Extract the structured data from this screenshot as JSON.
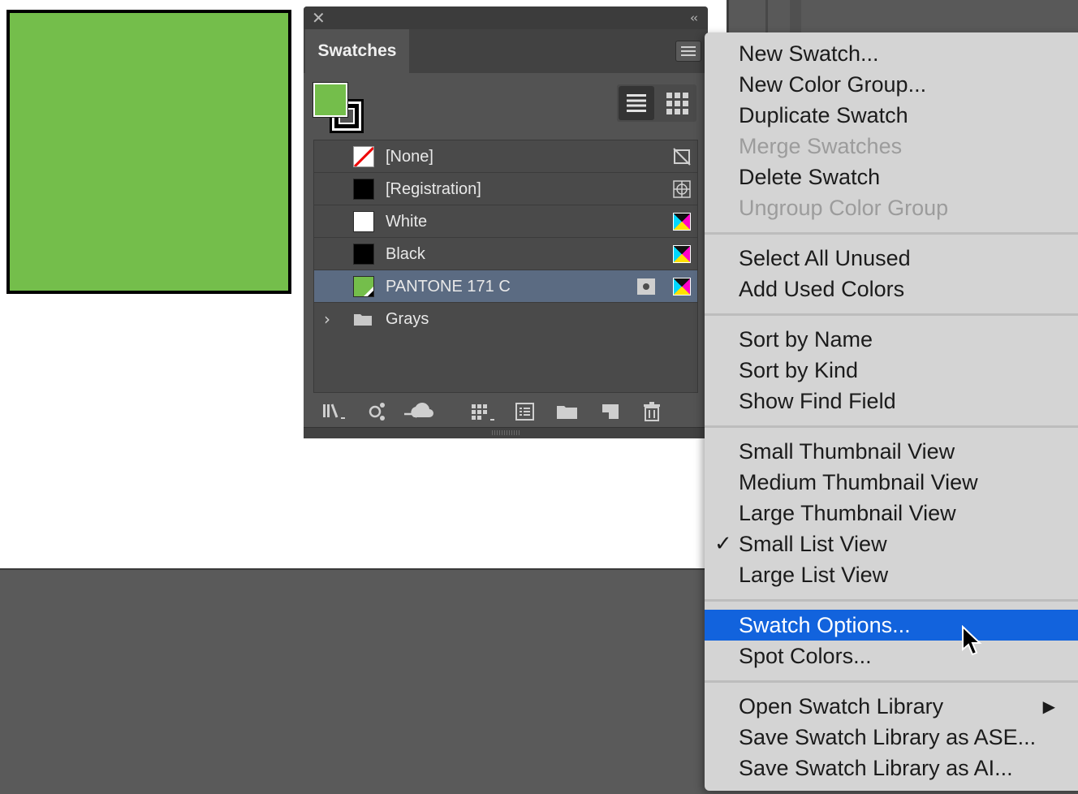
{
  "artwork": {
    "fill_color": "#74be4b"
  },
  "panel": {
    "tab_label": "Swatches",
    "list_items": [
      {
        "label": "[None]",
        "chip": "none",
        "type_icon": "no-edit-icon"
      },
      {
        "label": "[Registration]",
        "chip": "#000000",
        "type_icon": "registration-target-icon"
      },
      {
        "label": "White",
        "chip": "#ffffff",
        "type_icon": "process-cmyk-icon"
      },
      {
        "label": "Black",
        "chip": "#000000",
        "type_icon": "process-cmyk-icon"
      },
      {
        "label": "PANTONE 171 C",
        "chip": "#74be4b",
        "type_icon": "process-cmyk-icon",
        "spot_icon": "spot-color-icon",
        "selected": true
      },
      {
        "label": "Grays",
        "chip": "folder",
        "expandable": true
      }
    ]
  },
  "menu": {
    "groups": [
      [
        {
          "label": "New Swatch..."
        },
        {
          "label": "New Color Group..."
        },
        {
          "label": "Duplicate Swatch"
        },
        {
          "label": "Merge Swatches",
          "disabled": true
        },
        {
          "label": "Delete Swatch"
        },
        {
          "label": "Ungroup Color Group",
          "disabled": true
        }
      ],
      [
        {
          "label": "Select All Unused"
        },
        {
          "label": "Add Used Colors"
        }
      ],
      [
        {
          "label": "Sort by Name"
        },
        {
          "label": "Sort by Kind"
        },
        {
          "label": "Show Find Field"
        }
      ],
      [
        {
          "label": "Small Thumbnail View"
        },
        {
          "label": "Medium Thumbnail View"
        },
        {
          "label": "Large Thumbnail View"
        },
        {
          "label": "Small List View",
          "checked": true
        },
        {
          "label": "Large List View"
        }
      ],
      [
        {
          "label": "Swatch Options...",
          "highlighted": true
        },
        {
          "label": "Spot Colors..."
        }
      ],
      [
        {
          "label": "Open Swatch Library",
          "submenu": true
        },
        {
          "label": "Save Swatch Library as ASE..."
        },
        {
          "label": "Save Swatch Library as AI..."
        }
      ]
    ]
  },
  "colors": {
    "highlight": "#1263dd",
    "selected_row": "#5b6b82"
  }
}
